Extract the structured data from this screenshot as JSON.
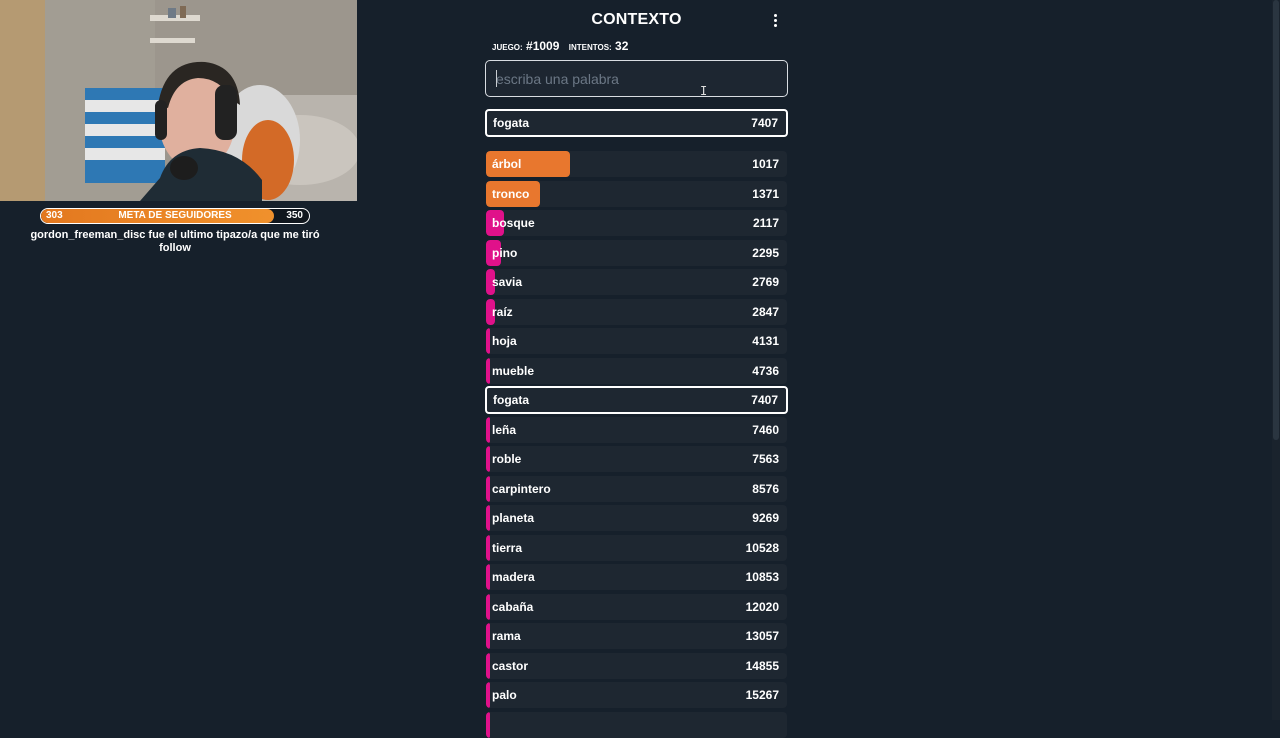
{
  "overlay": {
    "follower_goal": {
      "label": "META DE SEGUIDORES",
      "current": "303",
      "target": "350",
      "progress": 0.87
    },
    "alert_text": "gordon_freeman_disc fue el ultimo tipazo/a que me tiró follow"
  },
  "game": {
    "title": "CONTEXTO",
    "game_label": "JUEGO:",
    "game_number": "#1009",
    "attempts_label": "INTENTOS:",
    "attempts_value": "32",
    "input_placeholder": "escriba una palabra",
    "current_guess": {
      "word": "fogata",
      "rank": "7407"
    },
    "guesses": [
      {
        "word": "árbol",
        "rank": "1017",
        "color": "#e8772e",
        "fill": 0.28
      },
      {
        "word": "tronco",
        "rank": "1371",
        "color": "#e8772e",
        "fill": 0.18
      },
      {
        "word": "bosque",
        "rank": "2117",
        "color": "#e0118a",
        "fill": 0.06
      },
      {
        "word": "pino",
        "rank": "2295",
        "color": "#e0118a",
        "fill": 0.05
      },
      {
        "word": "savia",
        "rank": "2769",
        "color": "#e0118a",
        "fill": 0.03
      },
      {
        "word": "raíz",
        "rank": "2847",
        "color": "#e0118a",
        "fill": 0.03
      },
      {
        "word": "hoja",
        "rank": "4131",
        "color": "#e0118a",
        "fill": 0.01
      },
      {
        "word": "mueble",
        "rank": "4736",
        "color": "#e0118a",
        "fill": 0.01
      },
      {
        "word": "fogata",
        "rank": "7407",
        "color": "#e0118a",
        "fill": 0.01,
        "current": true
      },
      {
        "word": "leña",
        "rank": "7460",
        "color": "#e0118a",
        "fill": 0.01
      },
      {
        "word": "roble",
        "rank": "7563",
        "color": "#e0118a",
        "fill": 0.01
      },
      {
        "word": "carpintero",
        "rank": "8576",
        "color": "#e0118a",
        "fill": 0.01
      },
      {
        "word": "planeta",
        "rank": "9269",
        "color": "#e0118a",
        "fill": 0.01
      },
      {
        "word": "tierra",
        "rank": "10528",
        "color": "#e0118a",
        "fill": 0.01
      },
      {
        "word": "madera",
        "rank": "10853",
        "color": "#e0118a",
        "fill": 0.01
      },
      {
        "word": "cabaña",
        "rank": "12020",
        "color": "#e0118a",
        "fill": 0.01
      },
      {
        "word": "rama",
        "rank": "13057",
        "color": "#e0118a",
        "fill": 0.01
      },
      {
        "word": "castor",
        "rank": "14855",
        "color": "#e0118a",
        "fill": 0.01
      },
      {
        "word": "palo",
        "rank": "15267",
        "color": "#e0118a",
        "fill": 0.01
      },
      {
        "word": "",
        "rank": "",
        "color": "#e0118a",
        "fill": 0.01
      }
    ]
  }
}
